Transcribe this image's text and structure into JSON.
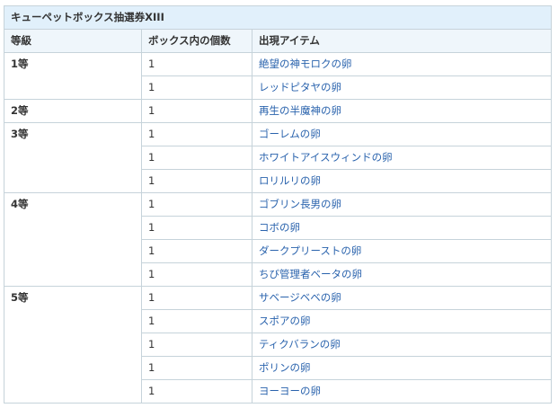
{
  "table": {
    "title": "キューペットボックス抽選券XIII",
    "headers": {
      "grade": "等級",
      "count": "ボックス内の個数",
      "item": "出現アイテム"
    },
    "groups": [
      {
        "grade": "1等",
        "rows": [
          {
            "count": "1",
            "item": "絶望の神モロクの卵"
          },
          {
            "count": "1",
            "item": "レッドピタヤの卵"
          }
        ]
      },
      {
        "grade": "2等",
        "rows": [
          {
            "count": "1",
            "item": "再生の半魔神の卵"
          }
        ]
      },
      {
        "grade": "3等",
        "rows": [
          {
            "count": "1",
            "item": "ゴーレムの卵"
          },
          {
            "count": "1",
            "item": "ホワイトアイスウィンドの卵"
          },
          {
            "count": "1",
            "item": "ロリルリの卵"
          }
        ]
      },
      {
        "grade": "4等",
        "rows": [
          {
            "count": "1",
            "item": "ゴブリン長男の卵"
          },
          {
            "count": "1",
            "item": "コボの卵"
          },
          {
            "count": "1",
            "item": "ダークプリーストの卵"
          },
          {
            "count": "1",
            "item": "ちび管理者ベータの卵"
          }
        ]
      },
      {
        "grade": "5等",
        "rows": [
          {
            "count": "1",
            "item": "サベージベベの卵"
          },
          {
            "count": "1",
            "item": "スポアの卵"
          },
          {
            "count": "1",
            "item": "ティクバランの卵"
          },
          {
            "count": "1",
            "item": "ポリンの卵"
          },
          {
            "count": "1",
            "item": "ヨーヨーの卵"
          }
        ]
      }
    ]
  },
  "colors": {
    "title_bg": "#e1f0fb",
    "header_bg": "#eff6fb",
    "border": "#c6d3da",
    "link": "#2a63ad",
    "text": "#333333"
  }
}
